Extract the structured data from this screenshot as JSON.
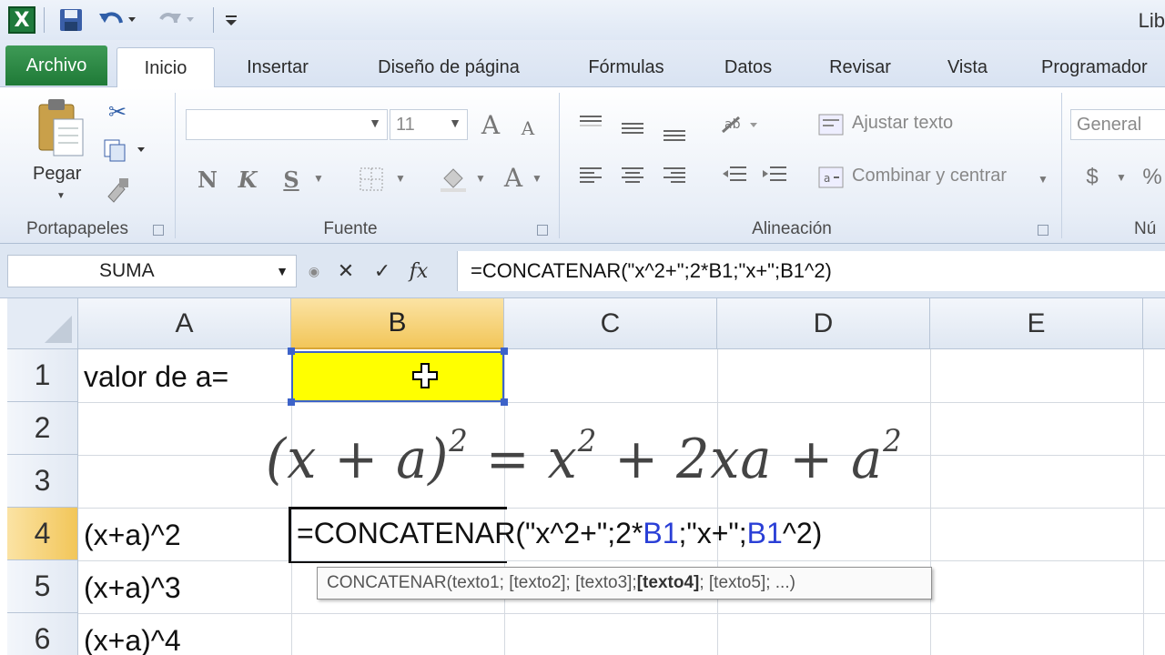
{
  "titlebar": {
    "app_icon": "excel-icon",
    "title": "Lib"
  },
  "tabs": {
    "file": "Archivo",
    "items": [
      "Inicio",
      "Insertar",
      "Diseño de página",
      "Fórmulas",
      "Datos",
      "Revisar",
      "Vista",
      "Programador"
    ]
  },
  "ribbon": {
    "clipboard": {
      "paste_label": "Pegar",
      "group": "Portapapeles"
    },
    "font": {
      "font_name": "",
      "font_size": "11",
      "bold": "N",
      "italic": "K",
      "underline": "S",
      "grow": "A",
      "shrink": "A",
      "font_color": "A",
      "group": "Fuente"
    },
    "alignment": {
      "wrap": "Ajustar texto",
      "merge": "Combinar y centrar",
      "group": "Alineación"
    },
    "number": {
      "format": "General",
      "currency": "$",
      "percent": "%",
      "group": "Nú"
    }
  },
  "formula_bar": {
    "name_box": "SUMA",
    "cancel": "✕",
    "enter": "✓",
    "fx": "fx",
    "formula": "=CONCATENAR(\"x^2+\";2*B1;\"x+\";B1^2)"
  },
  "grid": {
    "columns": [
      "A",
      "B",
      "C",
      "D",
      "E"
    ],
    "rows": [
      "1",
      "2",
      "3",
      "4",
      "5",
      "6"
    ],
    "cells": {
      "A1": "valor de a=",
      "A4": "(x+a)^2",
      "A5": "(x+a)^3",
      "A6": "(x+a)^4"
    },
    "equation": {
      "lhs": "(x + a)",
      "exp": "2",
      "eq": " = x",
      "exp2": "2",
      "mid": " + 2xa + a",
      "exp3": "2"
    },
    "editing": {
      "part1": "=CONCATENAR(\"x^2+\";2*",
      "ref1": "B1",
      "part2": ";\"x+\";",
      "ref2": "B1",
      "part3": "^2)"
    },
    "tooltip": {
      "fn": "CONCATENAR(texto1; [texto2]; [texto3]; ",
      "bold": "[texto4]",
      "rest": "; [texto5]; ...)"
    }
  },
  "colors": {
    "selection": "#3d63c9",
    "highlight": "#ffff00",
    "ref": "#2a3fd6",
    "file_tab": "#1f7a37"
  }
}
